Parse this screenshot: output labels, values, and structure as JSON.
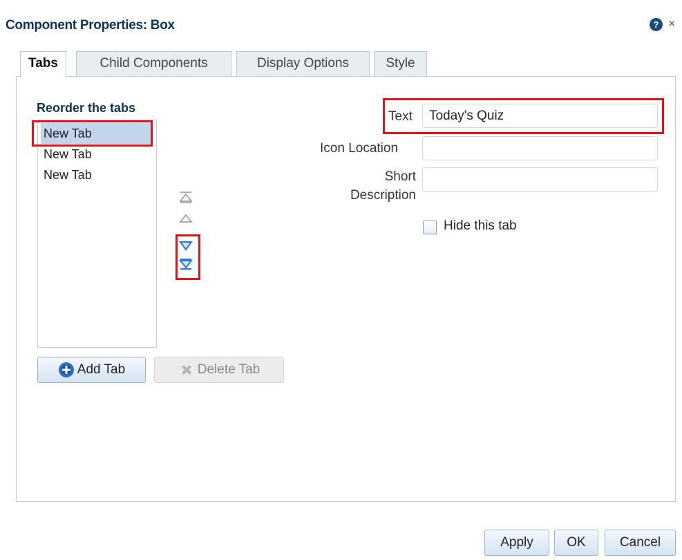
{
  "dialog": {
    "title": "Component Properties: Box",
    "help_icon": "question-circle-icon",
    "close_icon": "close-icon",
    "help_glyph": "?",
    "close_glyph": "×"
  },
  "tabs": [
    {
      "label": "Tabs",
      "active": true
    },
    {
      "label": "Child Components",
      "active": false
    },
    {
      "label": "Display Options",
      "active": false
    },
    {
      "label": "Style",
      "active": false
    }
  ],
  "reorder": {
    "heading": "Reorder the tabs",
    "items": [
      "New Tab",
      "New Tab",
      "New Tab"
    ],
    "selected_index": 0,
    "controls": [
      "move-to-top-icon",
      "move-up-icon",
      "move-down-icon",
      "move-to-bottom-icon"
    ]
  },
  "buttons": {
    "add_tab": "Add Tab",
    "delete_tab": "Delete Tab",
    "apply": "Apply",
    "ok": "OK",
    "cancel": "Cancel"
  },
  "fields": {
    "text_label": "Text",
    "text_value": "Today's Quiz",
    "icon_location_label": "Icon Location",
    "icon_location_value": "",
    "short_description_label_1": "Short",
    "short_description_label_2": "Description",
    "short_description_value": ""
  },
  "checkbox": {
    "label": "Hide this tab",
    "checked": false
  },
  "colors": {
    "highlight": "#e0121c",
    "title": "#0f3453",
    "selection": "#c3d5ec",
    "accent_arrow": "#2c7ad6"
  }
}
